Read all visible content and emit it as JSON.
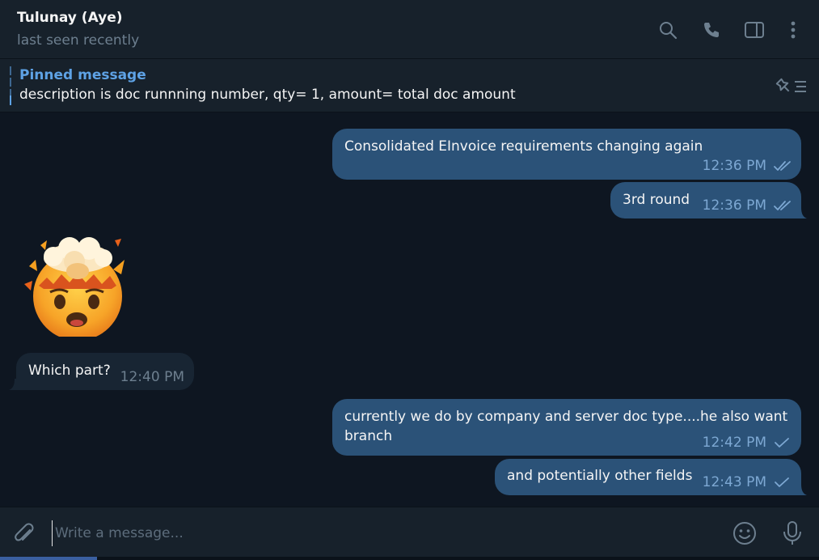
{
  "header": {
    "contact_name": "Tulunay (Aye)",
    "status": "last seen recently",
    "icons": [
      "search-icon",
      "phone-icon",
      "sidebar-toggle-icon",
      "more-vertical-icon"
    ]
  },
  "pinned": {
    "title": "Pinned message",
    "text": "description is doc runnning number, qty= 1, amount= total doc amount",
    "icon": "pinned-list-icon"
  },
  "messages": [
    {
      "direction": "out",
      "text": "Consolidated EInvoice requirements changing again",
      "time": "12:36 PM",
      "status": "read"
    },
    {
      "direction": "out",
      "text": "3rd round",
      "time": "12:36 PM",
      "status": "read"
    },
    {
      "direction": "in",
      "type": "sticker",
      "sticker": "exploding-head-emoji"
    },
    {
      "direction": "in",
      "text": "Which part?",
      "time": "12:40 PM"
    },
    {
      "direction": "out",
      "text_lines": [
        "currently we do by company and server doc type....he also want",
        "branch"
      ],
      "time": "12:42 PM",
      "status": "sent"
    },
    {
      "direction": "out",
      "text": "and potentially other fields",
      "time": "12:43 PM",
      "status": "sent"
    }
  ],
  "composer": {
    "placeholder": "Write a message...",
    "icons": [
      "paperclip-icon",
      "emoji-icon",
      "microphone-icon"
    ]
  },
  "colors": {
    "app_bg": "#0e1621",
    "panel_bg": "#17212b",
    "outgoing_bubble": "#2b5278",
    "incoming_bubble": "#182533",
    "accent": "#5ea2e5",
    "muted_text": "#6d7f8f"
  }
}
